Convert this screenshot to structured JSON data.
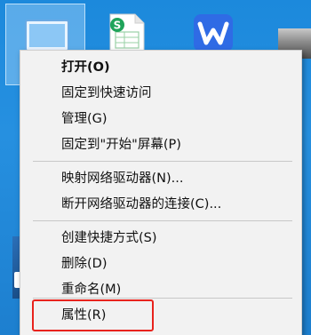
{
  "desktop": {
    "icons": [
      "this-pc-icon",
      "spreadsheet-icon",
      "wps-icon",
      "photo-icon",
      "app-icon"
    ]
  },
  "context_menu": {
    "items": [
      {
        "label": "打开(O)",
        "bold": true
      },
      {
        "label": "固定到快速访问"
      },
      {
        "label": "管理(G)"
      },
      {
        "label": "固定到\"开始\"屏幕(P)"
      },
      {
        "label": "映射网络驱动器(N)..."
      },
      {
        "label": "断开网络驱动器的连接(C)..."
      },
      {
        "label": "创建快捷方式(S)"
      },
      {
        "label": "删除(D)"
      },
      {
        "label": "重命名(M)"
      },
      {
        "label": "属性(R)"
      }
    ],
    "highlighted_item": "属性(R)",
    "highlight_color": "#e8231d"
  },
  "icon_labels": {
    "sheet_badge": "S",
    "wps_letter": "W"
  }
}
